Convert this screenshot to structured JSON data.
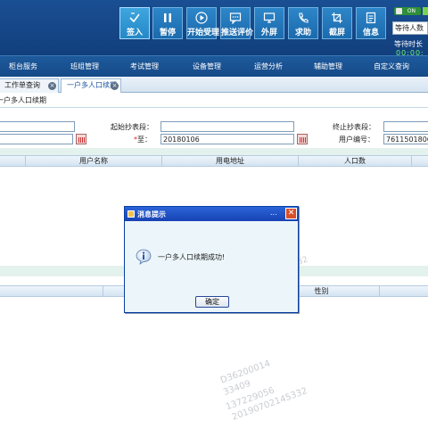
{
  "toolbar": {
    "buttons": [
      {
        "label": "签入"
      },
      {
        "label": "暂停"
      },
      {
        "label": "开始受理"
      },
      {
        "label": "推送评价"
      },
      {
        "label": "外屏"
      },
      {
        "label": "求助"
      },
      {
        "label": "截屏"
      },
      {
        "label": "信息"
      }
    ]
  },
  "status": {
    "toggle_text": "ON",
    "waiting_count_label": "等待人数",
    "waiting_time_label": "等待时长",
    "timer": "00:00:"
  },
  "menu": {
    "items": [
      "柜台服务",
      "班组管理",
      "考试管理",
      "设备管理",
      "运营分析",
      "辅助管理",
      "自定义查询"
    ]
  },
  "tabs": [
    {
      "label": "工作单查询"
    },
    {
      "label": "一户多人口续期"
    }
  ],
  "breadcrumb": "一户多人口续期",
  "form": {
    "start_meter_label": "起始抄表段：",
    "end_meter_label": "终止抄表段：",
    "to_label": "至：",
    "to_required_mark": "*",
    "to_value": "20180106",
    "user_number_label": "用户编号：",
    "user_number_value": "7611501806"
  },
  "grid1": {
    "headers": [
      "用户名称",
      "用电地址",
      "人口数"
    ]
  },
  "grid2": {
    "headers": [
      "性别"
    ]
  },
  "watermark": {
    "lines": [
      "D36200014",
      "33409",
      "137229056",
      "20190702145332"
    ],
    "fragment": "32"
  },
  "dialog": {
    "title": "消息提示",
    "title_dots": "...",
    "message": "一户多人口续期成功!",
    "ok_label": "确定"
  }
}
